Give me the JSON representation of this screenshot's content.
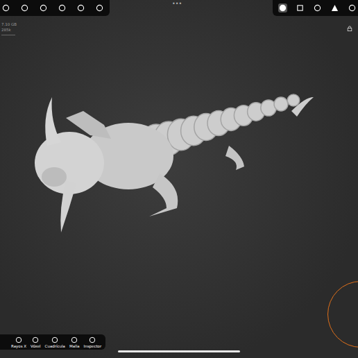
{
  "top_left_tools": [
    {
      "name": "cropped"
    },
    {
      "name": "globe"
    },
    {
      "name": "sun"
    },
    {
      "name": "material"
    },
    {
      "name": "image"
    },
    {
      "name": "video"
    }
  ],
  "top_center": "•••",
  "stats": [
    "7.10 GB",
    "285k"
  ],
  "top_right_tools": [
    {
      "name": "shading",
      "selected": true
    },
    {
      "name": "frame",
      "selected": false
    },
    {
      "name": "snap",
      "selected": false
    },
    {
      "name": "wire",
      "selected": false
    },
    {
      "name": "settings",
      "selected": false
    }
  ],
  "bottom_tools": [
    {
      "label": "Rayos X"
    },
    {
      "label": "Vóxel"
    },
    {
      "label": "Cuadrícula"
    },
    {
      "label": "Malla"
    },
    {
      "label": "Inspector"
    }
  ]
}
